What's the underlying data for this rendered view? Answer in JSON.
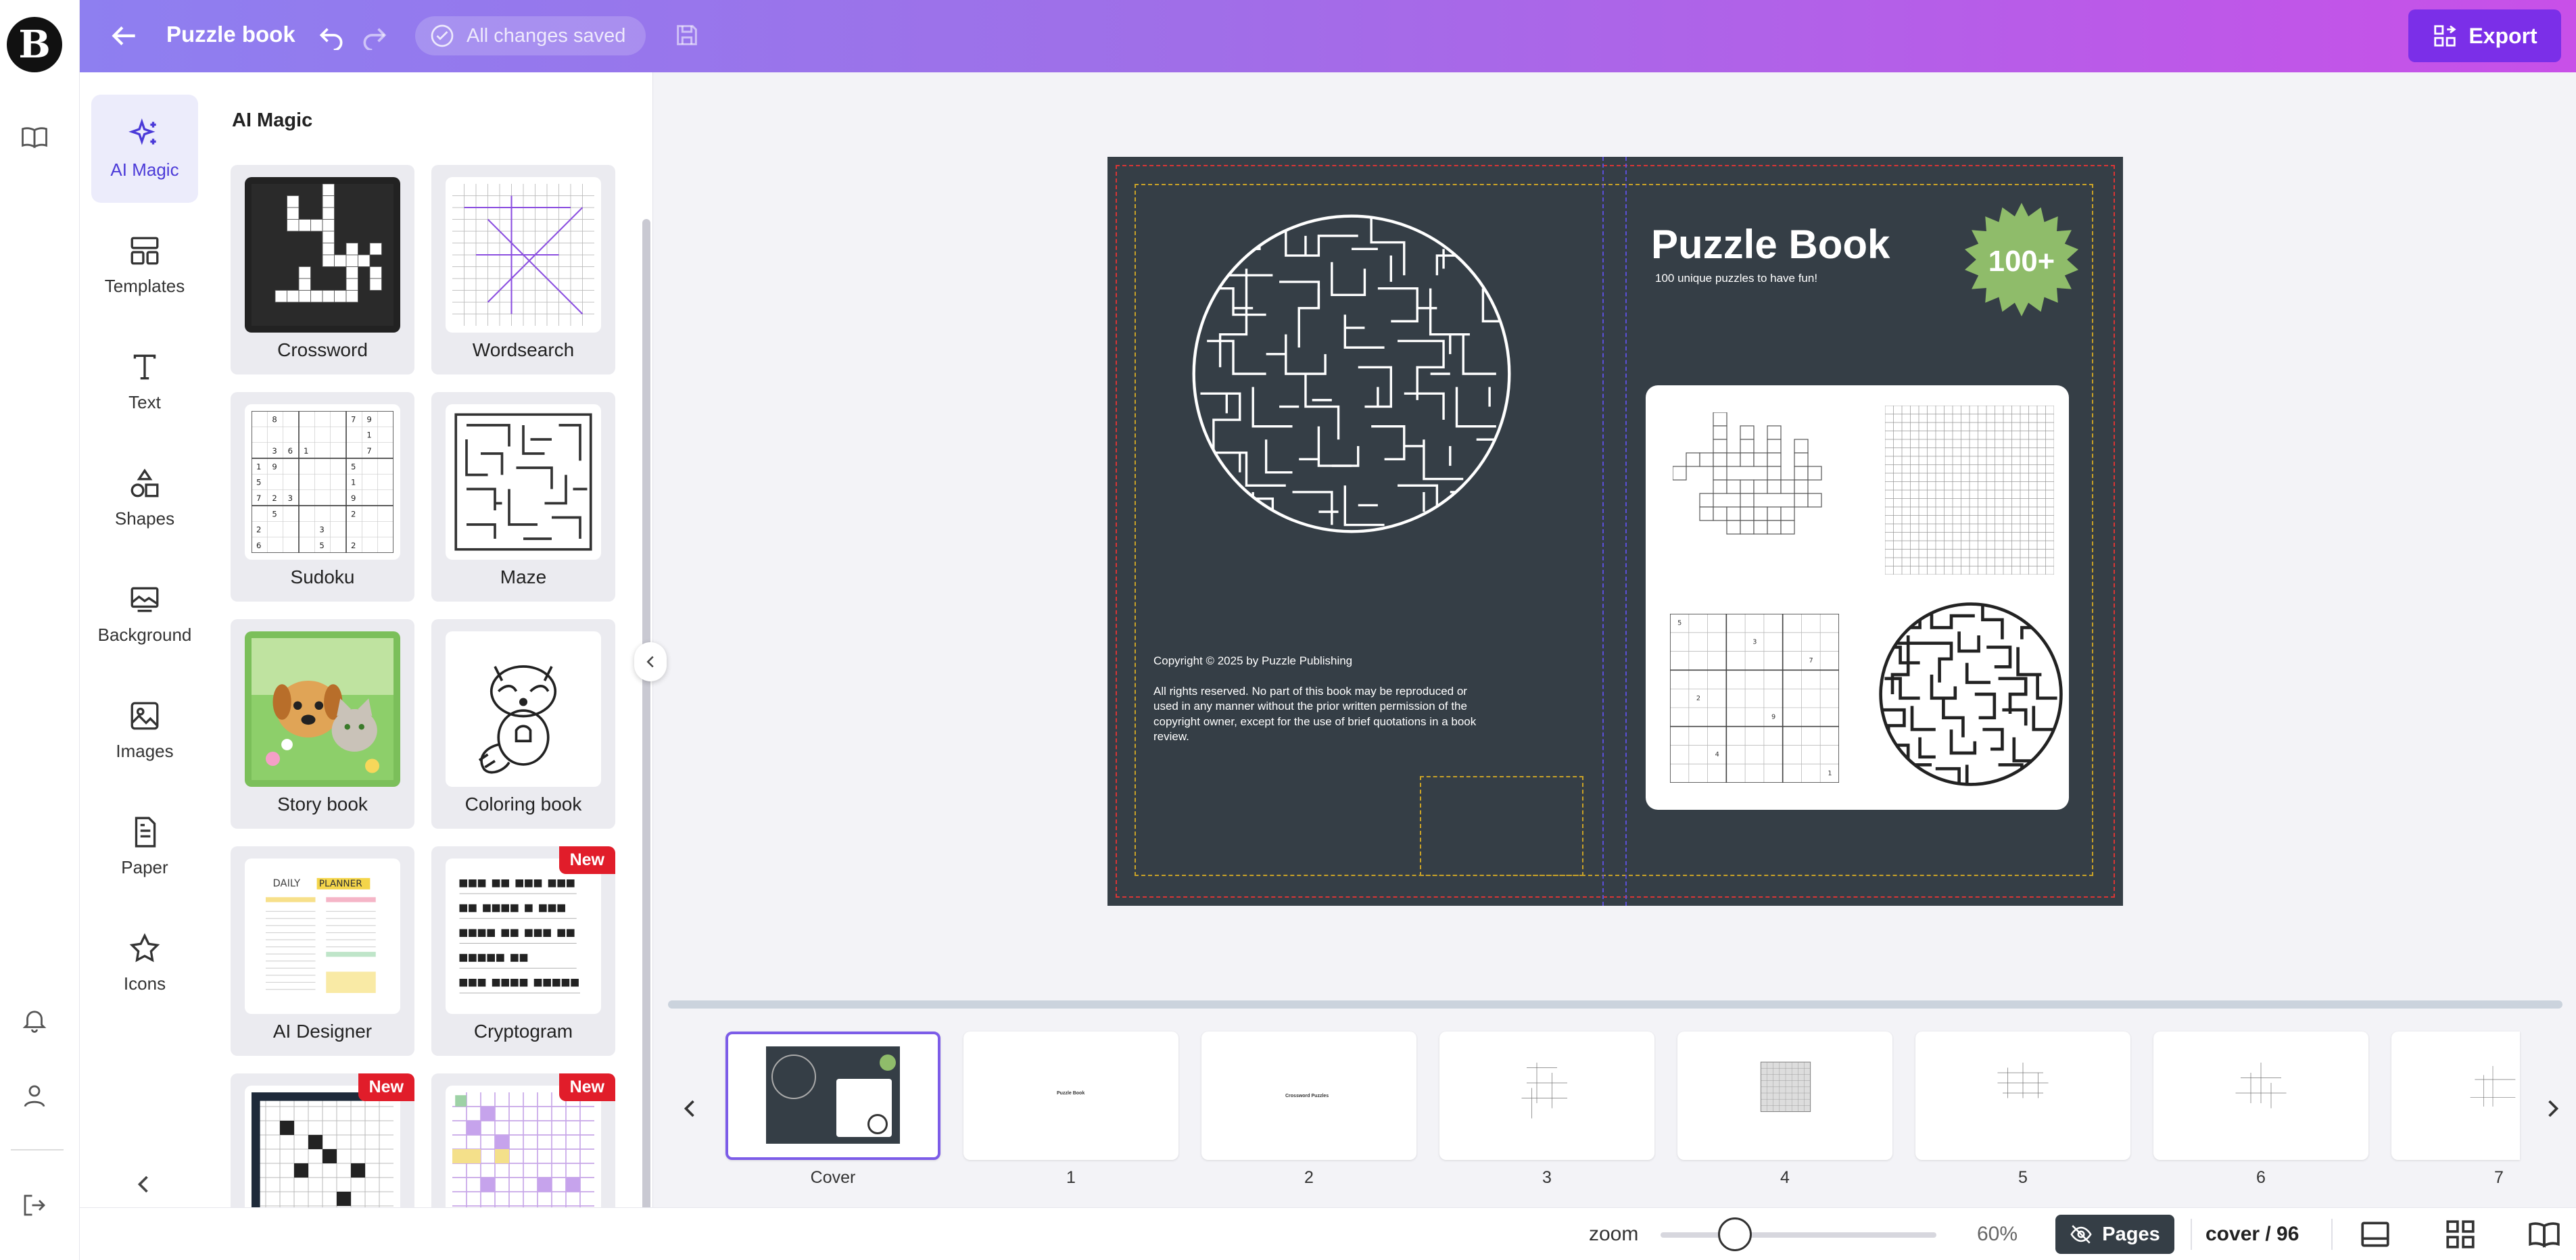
{
  "app": {
    "logo_letter": "B"
  },
  "header": {
    "title": "Puzzle book",
    "save_status": "All changes saved",
    "export_label": "Export"
  },
  "tools": [
    {
      "label": "AI Magic",
      "icon": "sparkles-icon"
    },
    {
      "label": "Templates",
      "icon": "templates-icon"
    },
    {
      "label": "Text",
      "icon": "text-icon"
    },
    {
      "label": "Shapes",
      "icon": "shapes-icon"
    },
    {
      "label": "Background",
      "icon": "background-icon"
    },
    {
      "label": "Images",
      "icon": "image-icon"
    },
    {
      "label": "Paper",
      "icon": "paper-icon"
    },
    {
      "label": "Icons",
      "icon": "star-icon"
    }
  ],
  "panel": {
    "title": "AI Magic",
    "cards": [
      {
        "label": "Crossword"
      },
      {
        "label": "Wordsearch"
      },
      {
        "label": "Sudoku"
      },
      {
        "label": "Maze"
      },
      {
        "label": "Story book"
      },
      {
        "label": "Coloring book"
      },
      {
        "label": "AI Designer"
      },
      {
        "label": "Cryptogram",
        "badge": "New"
      },
      {
        "label": "",
        "badge": "New"
      },
      {
        "label": "",
        "badge": "New"
      }
    ]
  },
  "cover": {
    "title": "Puzzle Book",
    "subtitle": "100 unique puzzles to have fun!",
    "badge": "100+",
    "copyright": "Copyright © 2025  by Puzzle Publishing",
    "rights": "All rights reserved. No part of this book may be reproduced or used in any manner without the prior written permission of the copyright owner, except for the use of brief quotations in a book review.",
    "colors": {
      "background": "#353e46",
      "badge": "#8fbc6a"
    }
  },
  "pages": [
    {
      "label": "Cover"
    },
    {
      "label": "1",
      "mini": "Puzzle Book"
    },
    {
      "label": "2",
      "mini": "Crossword Puzzles"
    },
    {
      "label": "3"
    },
    {
      "label": "4"
    },
    {
      "label": "5"
    },
    {
      "label": "6"
    },
    {
      "label": "7"
    }
  ],
  "footer": {
    "zoom_label": "zoom",
    "zoom_value": "60%",
    "zoom_fraction": 0.27,
    "pages_label": "Pages",
    "page_count": "cover / 96"
  },
  "colors": {
    "accent": "#7b2fe8",
    "new_badge": "#e11d2a"
  }
}
